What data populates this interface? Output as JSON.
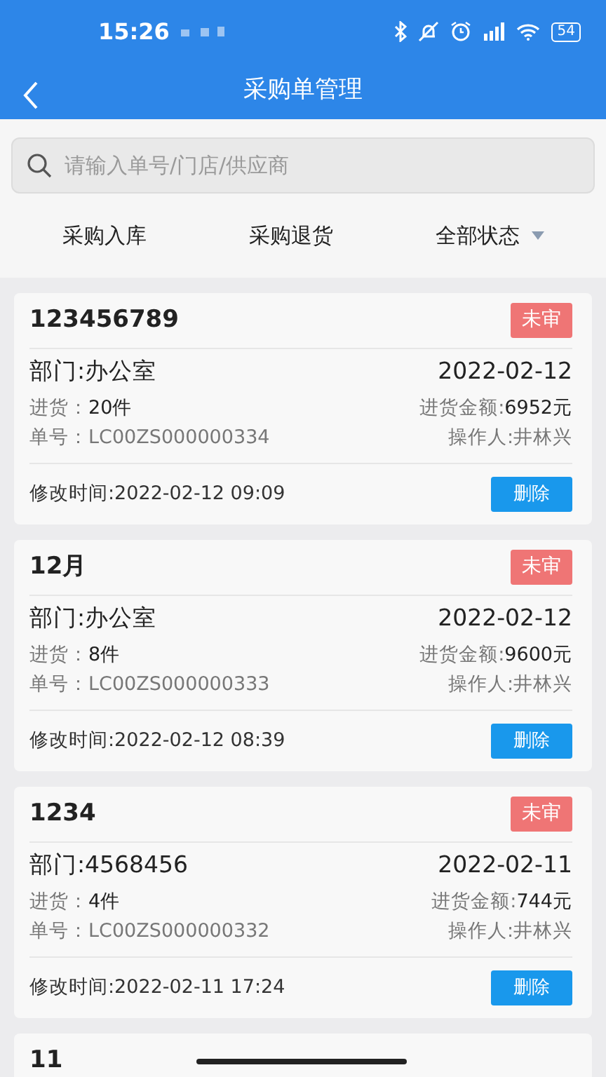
{
  "status_bar": {
    "time": "15:26",
    "battery": "54"
  },
  "header": {
    "title": "采购单管理"
  },
  "search": {
    "placeholder": "请输入单号/门店/供应商"
  },
  "filters": [
    {
      "label": "采购入库",
      "dropdown": false
    },
    {
      "label": "采购退货",
      "dropdown": false
    },
    {
      "label": "全部状态",
      "dropdown": true
    }
  ],
  "orders": [
    {
      "title": "123456789",
      "status": "未审",
      "department": "部门:办公室",
      "date": "2022-02-12",
      "qty_label": "进货：",
      "qty": "20件",
      "amount_label": "进货金额:",
      "amount": "6952元",
      "order_no": "单号：LC00ZS000000334",
      "operator": "操作人:井林兴",
      "modified": "修改时间:2022-02-12 09:09",
      "delete": "删除"
    },
    {
      "title": "12月",
      "status": "未审",
      "department": "部门:办公室",
      "date": "2022-02-12",
      "qty_label": "进货：",
      "qty": "8件",
      "amount_label": "进货金额:",
      "amount": "9600元",
      "order_no": "单号：LC00ZS000000333",
      "operator": "操作人:井林兴",
      "modified": "修改时间:2022-02-12 08:39",
      "delete": "删除"
    },
    {
      "title": "1234",
      "status": "未审",
      "department": "部门:4568456",
      "date": "2022-02-11",
      "qty_label": "进货：",
      "qty": "4件",
      "amount_label": "进货金额:",
      "amount": "744元",
      "order_no": "单号：LC00ZS000000332",
      "operator": "操作人:井林兴",
      "modified": "修改时间:2022-02-11 17:24",
      "delete": "删除"
    },
    {
      "title": "11"
    }
  ]
}
